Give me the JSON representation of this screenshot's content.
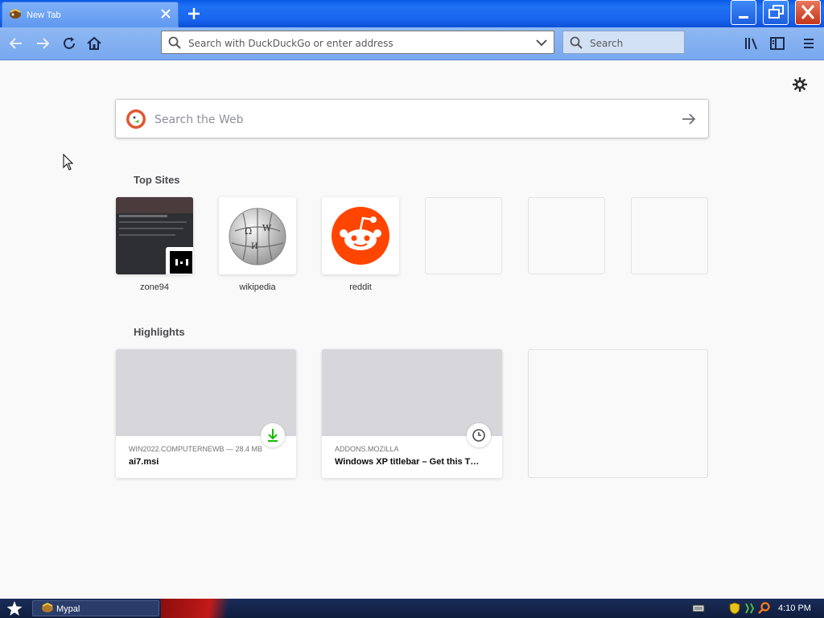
{
  "browser": {
    "tab_title": "New Tab",
    "address_placeholder": "Search with DuckDuckGo or enter address",
    "search_placeholder": "Search"
  },
  "newtab": {
    "web_search_placeholder": "Search the Web",
    "top_sites_title": "Top Sites",
    "top_sites": [
      {
        "label": "zone94",
        "icon": "zone94-screenshot"
      },
      {
        "label": "wikipedia",
        "icon": "wikipedia-globe-icon"
      },
      {
        "label": "reddit",
        "icon": "reddit-alien-icon"
      }
    ],
    "highlights_title": "Highlights",
    "highlights": [
      {
        "meta": "WIN2022.COMPUTERNEWB — 28.4 MB",
        "name": "ai7.msi",
        "badge": "download-icon"
      },
      {
        "meta": "ADDONS.MOZILLA",
        "name": "Windows XP titlebar – Get this T…",
        "badge": "clock-icon"
      }
    ]
  },
  "taskbar": {
    "app_label": "Mypal",
    "clock": "4:10 PM"
  },
  "colors": {
    "titlebar": "#1a64ee",
    "navbar": "#8fb8f3",
    "reddit": "#ff4500",
    "download_green": "#12bc00"
  }
}
